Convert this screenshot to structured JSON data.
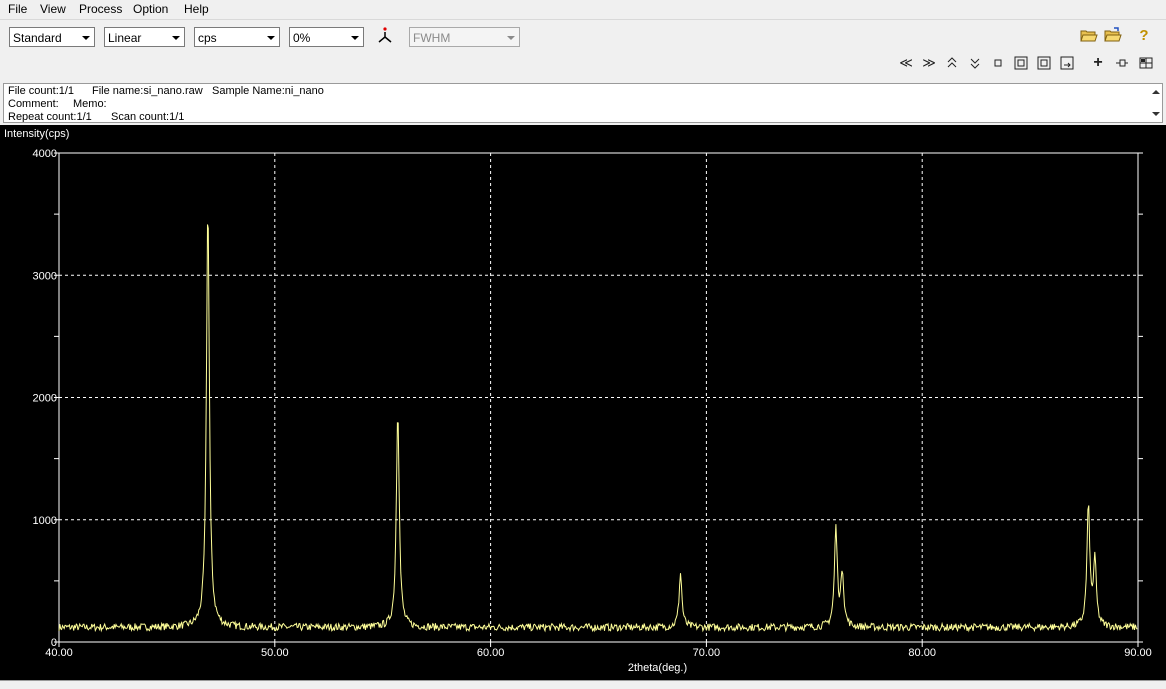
{
  "menu": [
    "File",
    "View",
    "Process",
    "Option",
    "Help"
  ],
  "toolbar": {
    "mode": "Standard",
    "scale": "Linear",
    "unit": "cps",
    "percent": "0%",
    "peak_mode": "FWHM"
  },
  "info": {
    "file_count": "File count:1/1",
    "file_name": "File name:si_nano.raw",
    "sample_name": "Sample Name:ni_nano",
    "comment": "Comment:",
    "memo": "Memo:",
    "repeat_count": "Repeat count:1/1",
    "scan_count": "Scan count:1/1"
  },
  "chart_data": {
    "type": "line",
    "ylabel": "Intensity(cps)",
    "xlabel": "2theta(deg.)",
    "xlim": [
      40,
      90
    ],
    "ylim": [
      0,
      4000
    ],
    "x_ticks": [
      "40.00",
      "50.00",
      "60.00",
      "70.00",
      "80.00",
      "90.00"
    ],
    "y_ticks": [
      "0",
      "1000",
      "2000",
      "3000",
      "4000"
    ],
    "grid": true,
    "line_color": "#ffff99",
    "baseline_cps": 120,
    "peaks": [
      {
        "x": 46.9,
        "y": 3600
      },
      {
        "x": 55.7,
        "y": 1920
      },
      {
        "x": 68.8,
        "y": 560
      },
      {
        "x": 76.0,
        "y": 920
      },
      {
        "x": 76.3,
        "y": 560
      },
      {
        "x": 87.7,
        "y": 1100
      },
      {
        "x": 88.0,
        "y": 650
      }
    ]
  }
}
